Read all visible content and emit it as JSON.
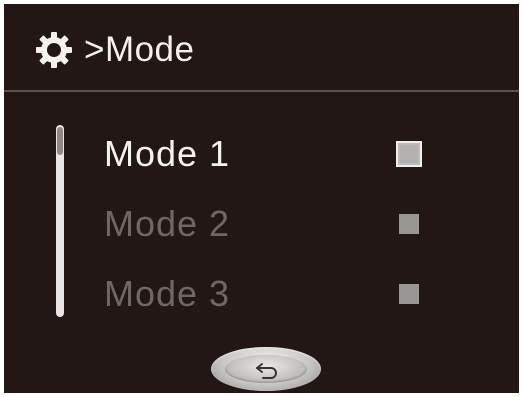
{
  "header": {
    "title": ">Mode",
    "icon": "gear-icon"
  },
  "modes": [
    {
      "label": "Mode 1",
      "selected": true
    },
    {
      "label": "Mode 2",
      "selected": false
    },
    {
      "label": "Mode 3",
      "selected": false
    }
  ],
  "scroll": {
    "position": 0
  },
  "footer": {
    "back_icon": "return-arrow-icon"
  },
  "colors": {
    "background": "#221714",
    "text_active": "#f5f3f1",
    "text_inactive": "#6e6764"
  }
}
